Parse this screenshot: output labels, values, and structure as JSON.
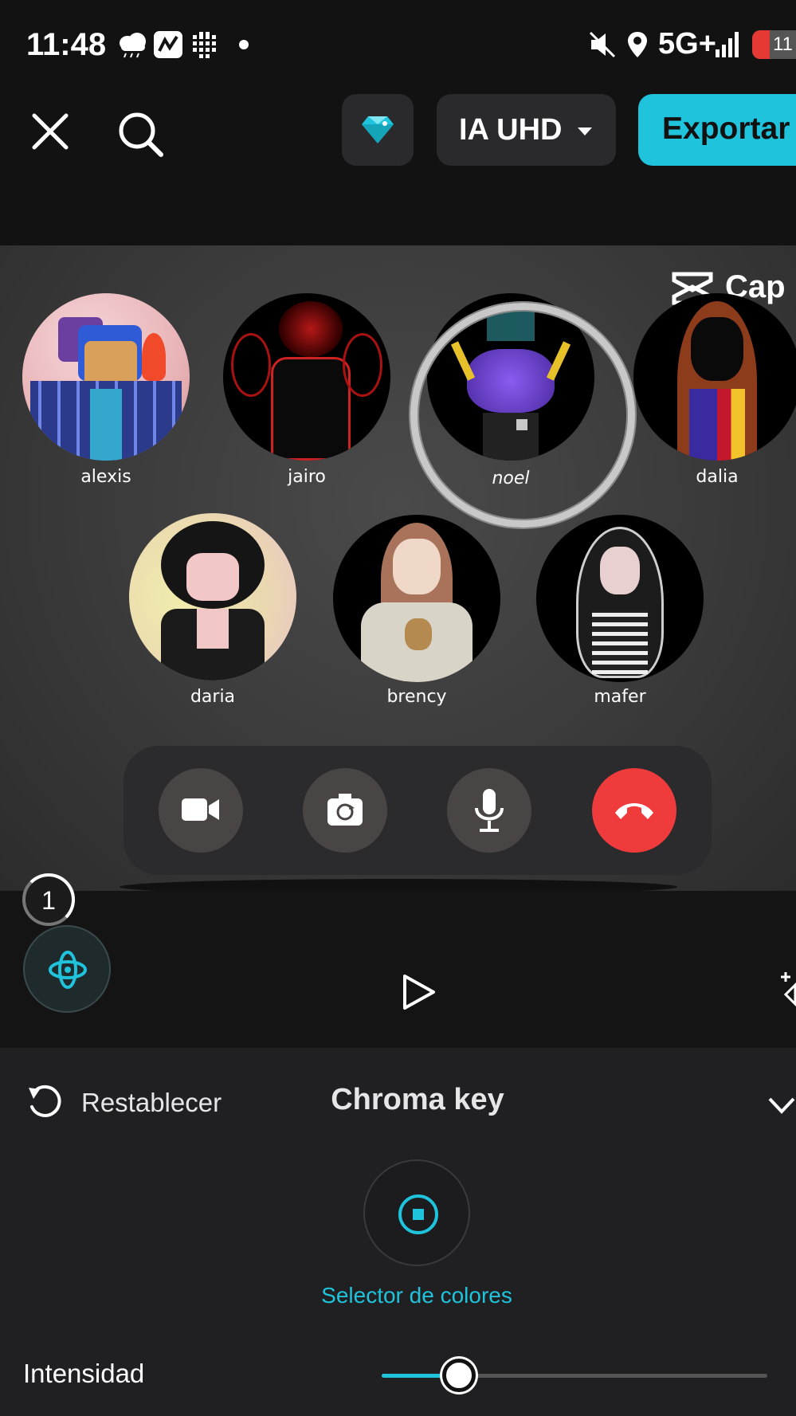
{
  "status_bar": {
    "time": "11:48",
    "network": "5G+",
    "battery": "11"
  },
  "top_bar": {
    "quality_label": "IA UHD",
    "export_label": "Exportar"
  },
  "preview": {
    "watermark": "Cap",
    "participants": [
      {
        "name": "alexis"
      },
      {
        "name": "jairo"
      },
      {
        "name": "noel"
      },
      {
        "name": "dalia"
      },
      {
        "name": "daria"
      },
      {
        "name": "brency"
      },
      {
        "name": "mafer"
      }
    ]
  },
  "timeline": {
    "badge_count": "1"
  },
  "panel": {
    "reset_label": "Restablecer",
    "title": "Chroma key",
    "color_picker_label": "Selector de colores",
    "intensity_label": "Intensidad",
    "intensity_value": 0.2
  },
  "colors": {
    "accent": "#1fc3dc",
    "hangup": "#ef3b3b",
    "background": "#121212",
    "panel": "#202022"
  }
}
